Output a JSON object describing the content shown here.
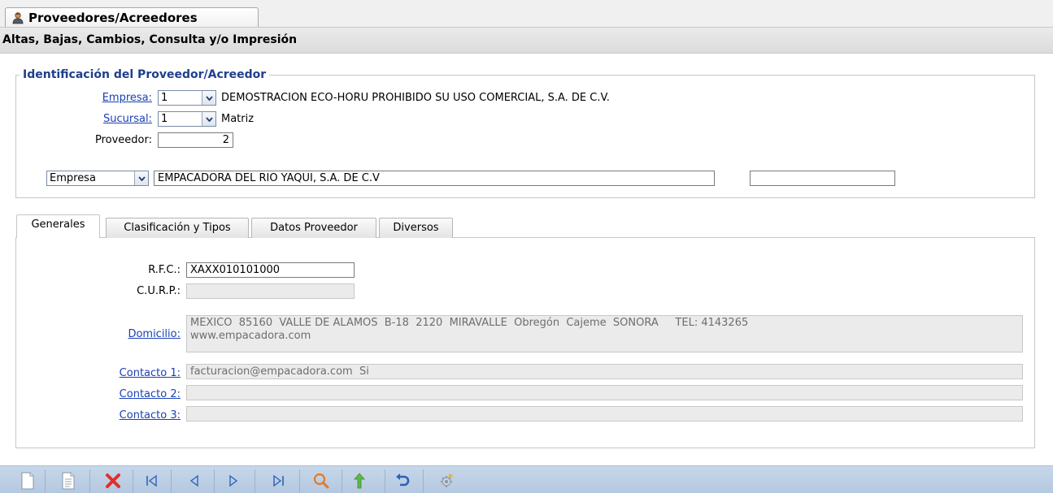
{
  "window_tab": {
    "title": "Proveedores/Acreedores",
    "icon": "user-icon"
  },
  "subheader": {
    "title": "Altas, Bajas, Cambios, Consulta y/o Impresión"
  },
  "identification": {
    "legend": "Identificación del Proveedor/Acreedor",
    "empresa": {
      "label": "Empresa:",
      "value": "1",
      "description": "DEMOSTRACION ECO-HORU PROHIBIDO SU USO COMERCIAL, S.A. DE C.V."
    },
    "sucursal": {
      "label": "Sucursal:",
      "value": "1",
      "description": "Matriz"
    },
    "proveedor": {
      "label": "Proveedor:",
      "value": "2"
    },
    "type_select": {
      "value": "Empresa"
    },
    "name": {
      "value": "EMPACADORA DEL RIO YAQUI, S.A. DE C.V"
    },
    "extra": {
      "value": ""
    }
  },
  "tabs": [
    {
      "label": "Generales",
      "active": true
    },
    {
      "label": "Clasificación y Tipos",
      "active": false
    },
    {
      "label": "Datos Proveedor",
      "active": false
    },
    {
      "label": "Diversos",
      "active": false
    }
  ],
  "generales": {
    "rfc": {
      "label": "R.F.C.:",
      "value": "XAXX010101000"
    },
    "curp": {
      "label": "C.U.R.P.:",
      "value": ""
    },
    "domicilio": {
      "label": "Domicilio:",
      "line1": "MEXICO  85160  VALLE DE ALAMOS  B-18  2120  MIRAVALLE  Obregón  Cajeme  SONORA     TEL: 4143265",
      "line2": "www.empacadora.com"
    },
    "contacto1": {
      "label": "Contacto 1:",
      "value": "facturacion@empacadora.com  Si"
    },
    "contacto2": {
      "label": "Contacto 2:",
      "value": ""
    },
    "contacto3": {
      "label": "Contacto 3:",
      "value": ""
    }
  },
  "toolbar": {
    "buttons": [
      "new-document-icon",
      "copy-document-icon",
      "delete-icon",
      "first-record-icon",
      "previous-record-icon",
      "next-record-icon",
      "last-record-icon",
      "search-icon",
      "upload-icon",
      "undo-icon",
      "settings-icon"
    ]
  },
  "colors": {
    "link": "#1a3fb5",
    "legend": "#1e3f8c",
    "toolbar": "#b4c8e0",
    "delete": "#e0302a"
  }
}
